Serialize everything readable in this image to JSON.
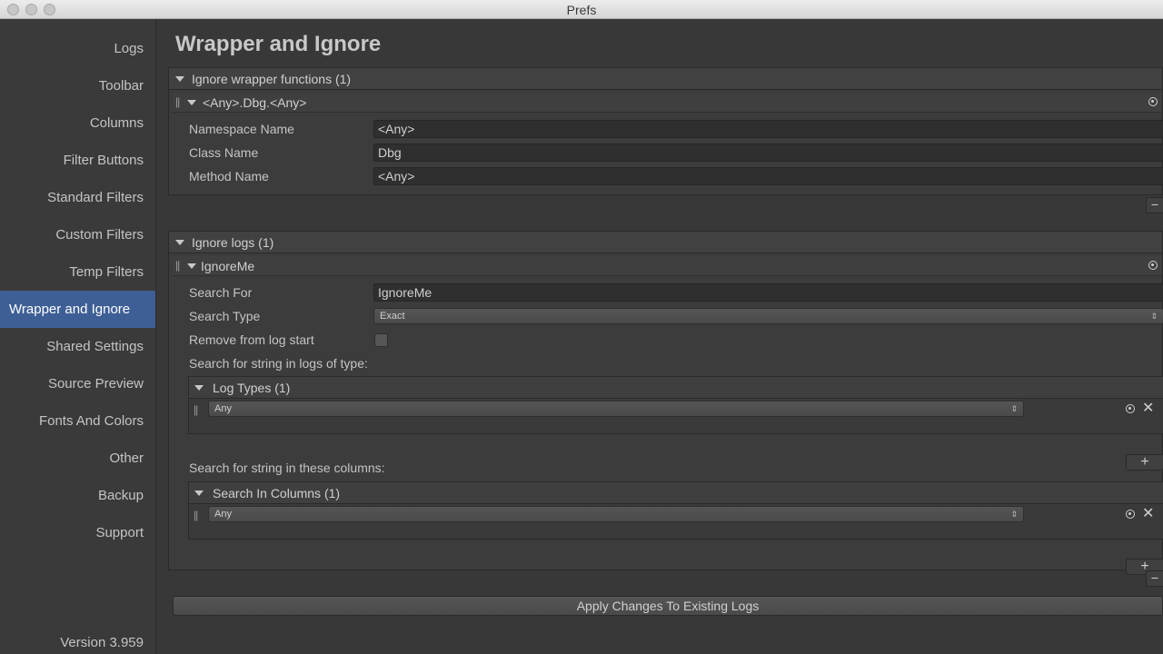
{
  "window": {
    "title": "Prefs"
  },
  "sidebar": {
    "items": [
      {
        "label": "Logs"
      },
      {
        "label": "Toolbar"
      },
      {
        "label": "Columns"
      },
      {
        "label": "Filter Buttons"
      },
      {
        "label": "Standard Filters"
      },
      {
        "label": "Custom Filters"
      },
      {
        "label": "Temp Filters"
      },
      {
        "label": "Wrapper and Ignore"
      },
      {
        "label": "Shared Settings"
      },
      {
        "label": "Source Preview"
      },
      {
        "label": "Fonts And Colors"
      },
      {
        "label": "Other"
      },
      {
        "label": "Backup"
      },
      {
        "label": "Support"
      }
    ],
    "active_index": 7,
    "version": "Version 3.959"
  },
  "main": {
    "title": "Wrapper and Ignore",
    "wrapper": {
      "header": "Ignore wrapper functions (1)",
      "item_title": "<Any>.Dbg.<Any>",
      "fields": [
        {
          "label": "Namespace Name",
          "value": "<Any>"
        },
        {
          "label": "Class Name",
          "value": "Dbg"
        },
        {
          "label": "Method Name",
          "value": "<Any>"
        }
      ]
    },
    "ignore": {
      "header": "Ignore logs (1)",
      "item_title": "IgnoreMe",
      "search_for_label": "Search For",
      "search_for_value": "IgnoreMe",
      "search_type_label": "Search Type",
      "search_type_value": "Exact",
      "remove_label": "Remove from log start",
      "remove_checked": false,
      "log_types_prompt": "Search for string in logs of type:",
      "log_types_header": "Log Types (1)",
      "log_types_value": "Any",
      "columns_prompt": "Search for string in these columns:",
      "columns_header": "Search In Columns (1)",
      "columns_value": "Any"
    },
    "glyphs": {
      "plus": "+",
      "minus": "−",
      "close": "✕",
      "grip": "||",
      "dd": "⇕"
    },
    "apply_label": "Apply Changes To Existing Logs"
  },
  "colors": {
    "accent": "#3e5f96",
    "background": "#383838"
  }
}
